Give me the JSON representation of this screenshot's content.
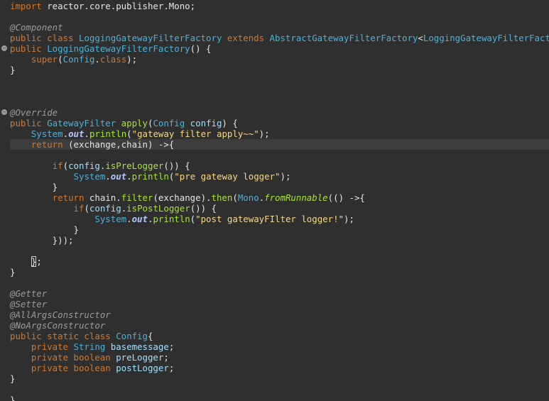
{
  "lines": [
    {
      "current": false,
      "fold": false,
      "tokens": [
        {
          "c": "t-kw",
          "t": "import "
        },
        {
          "c": "t-text",
          "t": "reactor.core.publisher.Mono;"
        }
      ]
    },
    {
      "current": false,
      "fold": false,
      "tokens": []
    },
    {
      "current": false,
      "fold": false,
      "tokens": [
        {
          "c": "t-ann",
          "t": "@Component"
        }
      ]
    },
    {
      "current": false,
      "fold": false,
      "tokens": [
        {
          "c": "t-kw",
          "t": "public class "
        },
        {
          "c": "t-type",
          "t": "LoggingGatewayFilterFactory "
        },
        {
          "c": "t-kw",
          "t": "extends "
        },
        {
          "c": "t-type",
          "t": "AbstractGatewayFilterFactory"
        },
        {
          "c": "t-text",
          "t": "<"
        },
        {
          "c": "t-type",
          "t": "LoggingGatewayFilterFactor"
        }
      ]
    },
    {
      "current": false,
      "fold": true,
      "tokens": [
        {
          "c": "t-kw",
          "t": "public "
        },
        {
          "c": "t-type",
          "t": "LoggingGatewayFilterFactory"
        },
        {
          "c": "t-text",
          "t": "() {"
        }
      ]
    },
    {
      "current": false,
      "fold": false,
      "tokens": [
        {
          "c": "t-text",
          "t": "    "
        },
        {
          "c": "t-kw",
          "t": "super"
        },
        {
          "c": "t-text",
          "t": "("
        },
        {
          "c": "t-type",
          "t": "Config"
        },
        {
          "c": "t-text",
          "t": "."
        },
        {
          "c": "t-kw",
          "t": "class"
        },
        {
          "c": "t-text",
          "t": ");"
        }
      ]
    },
    {
      "current": false,
      "fold": false,
      "tokens": [
        {
          "c": "t-text",
          "t": "}"
        }
      ]
    },
    {
      "current": false,
      "fold": false,
      "tokens": []
    },
    {
      "current": false,
      "fold": false,
      "tokens": []
    },
    {
      "current": false,
      "fold": false,
      "tokens": []
    },
    {
      "current": false,
      "fold": true,
      "tokens": [
        {
          "c": "t-ann",
          "t": "@Override"
        }
      ]
    },
    {
      "current": false,
      "fold": false,
      "tokens": [
        {
          "c": "t-kw",
          "t": "public "
        },
        {
          "c": "t-type",
          "t": "GatewayFilter "
        },
        {
          "c": "t-method",
          "t": "apply"
        },
        {
          "c": "t-text",
          "t": "("
        },
        {
          "c": "t-type",
          "t": "Config "
        },
        {
          "c": "t-field",
          "t": "config"
        },
        {
          "c": "t-text",
          "t": ") {"
        }
      ]
    },
    {
      "current": false,
      "fold": false,
      "tokens": [
        {
          "c": "t-text",
          "t": "    "
        },
        {
          "c": "t-type",
          "t": "System"
        },
        {
          "c": "t-text",
          "t": "."
        },
        {
          "c": "t-static",
          "t": "out"
        },
        {
          "c": "t-text",
          "t": "."
        },
        {
          "c": "t-method",
          "t": "println"
        },
        {
          "c": "t-text",
          "t": "("
        },
        {
          "c": "t-str",
          "t": "\"gateway filter apply~~\""
        },
        {
          "c": "t-text",
          "t": ");"
        }
      ]
    },
    {
      "current": true,
      "fold": false,
      "tokens": [
        {
          "c": "t-text",
          "t": "    "
        },
        {
          "c": "t-kw",
          "t": "return "
        },
        {
          "c": "t-text",
          "t": "(exchange,chain) ->{"
        }
      ]
    },
    {
      "current": false,
      "fold": false,
      "tokens": []
    },
    {
      "current": false,
      "fold": false,
      "tokens": [
        {
          "c": "t-text",
          "t": "        "
        },
        {
          "c": "t-kw",
          "t": "if"
        },
        {
          "c": "t-text",
          "t": "("
        },
        {
          "c": "t-field",
          "t": "config"
        },
        {
          "c": "t-text",
          "t": "."
        },
        {
          "c": "t-method",
          "t": "isPreLogger"
        },
        {
          "c": "t-text",
          "t": "()) {"
        }
      ]
    },
    {
      "current": false,
      "fold": false,
      "tokens": [
        {
          "c": "t-text",
          "t": "            "
        },
        {
          "c": "t-type",
          "t": "System"
        },
        {
          "c": "t-text",
          "t": "."
        },
        {
          "c": "t-static",
          "t": "out"
        },
        {
          "c": "t-text",
          "t": "."
        },
        {
          "c": "t-method",
          "t": "println"
        },
        {
          "c": "t-text",
          "t": "("
        },
        {
          "c": "t-str",
          "t": "\"pre gateway logger\""
        },
        {
          "c": "t-text",
          "t": ");"
        }
      ]
    },
    {
      "current": false,
      "fold": false,
      "tokens": [
        {
          "c": "t-text",
          "t": "        }"
        }
      ]
    },
    {
      "current": false,
      "fold": false,
      "tokens": [
        {
          "c": "t-text",
          "t": "        "
        },
        {
          "c": "t-kw",
          "t": "return "
        },
        {
          "c": "t-text",
          "t": "chain."
        },
        {
          "c": "t-method",
          "t": "filter"
        },
        {
          "c": "t-text",
          "t": "(exchange)."
        },
        {
          "c": "t-method",
          "t": "then"
        },
        {
          "c": "t-text",
          "t": "("
        },
        {
          "c": "t-type",
          "t": "Mono"
        },
        {
          "c": "t-text",
          "t": "."
        },
        {
          "c": "t-fn",
          "t": "fromRunnable"
        },
        {
          "c": "t-text",
          "t": "(() ->{"
        }
      ]
    },
    {
      "current": false,
      "fold": false,
      "tokens": [
        {
          "c": "t-text",
          "t": "            "
        },
        {
          "c": "t-kw",
          "t": "if"
        },
        {
          "c": "t-text",
          "t": "("
        },
        {
          "c": "t-field",
          "t": "config"
        },
        {
          "c": "t-text",
          "t": "."
        },
        {
          "c": "t-method",
          "t": "isPostLogger"
        },
        {
          "c": "t-text",
          "t": "()) {"
        }
      ]
    },
    {
      "current": false,
      "fold": false,
      "tokens": [
        {
          "c": "t-text",
          "t": "                "
        },
        {
          "c": "t-type",
          "t": "System"
        },
        {
          "c": "t-text",
          "t": "."
        },
        {
          "c": "t-static",
          "t": "out"
        },
        {
          "c": "t-text",
          "t": "."
        },
        {
          "c": "t-method",
          "t": "println"
        },
        {
          "c": "t-text",
          "t": "("
        },
        {
          "c": "t-str",
          "t": "\"post gatewayFIlter logger!\""
        },
        {
          "c": "t-text",
          "t": ");"
        }
      ]
    },
    {
      "current": false,
      "fold": false,
      "tokens": [
        {
          "c": "t-text",
          "t": "            }"
        }
      ]
    },
    {
      "current": false,
      "fold": false,
      "tokens": [
        {
          "c": "t-text",
          "t": "        }));"
        }
      ]
    },
    {
      "current": false,
      "fold": false,
      "tokens": []
    },
    {
      "current": false,
      "fold": false,
      "tokens": [
        {
          "c": "t-text",
          "t": "    "
        },
        {
          "c": "t-text cursor",
          "t": "}"
        },
        {
          "c": "t-text",
          "t": ";"
        }
      ]
    },
    {
      "current": false,
      "fold": false,
      "tokens": [
        {
          "c": "t-text",
          "t": "}"
        }
      ]
    },
    {
      "current": false,
      "fold": false,
      "tokens": []
    },
    {
      "current": false,
      "fold": false,
      "tokens": [
        {
          "c": "t-ann",
          "t": "@Getter"
        }
      ]
    },
    {
      "current": false,
      "fold": false,
      "tokens": [
        {
          "c": "t-ann",
          "t": "@Setter"
        }
      ]
    },
    {
      "current": false,
      "fold": false,
      "tokens": [
        {
          "c": "t-ann",
          "t": "@AllArgsConstructor"
        }
      ]
    },
    {
      "current": false,
      "fold": false,
      "tokens": [
        {
          "c": "t-ann",
          "t": "@NoArgsConstructor"
        }
      ]
    },
    {
      "current": false,
      "fold": false,
      "tokens": [
        {
          "c": "t-kw",
          "t": "public static class "
        },
        {
          "c": "t-type",
          "t": "Config"
        },
        {
          "c": "t-text",
          "t": "{"
        }
      ]
    },
    {
      "current": false,
      "fold": false,
      "tokens": [
        {
          "c": "t-text",
          "t": "    "
        },
        {
          "c": "t-kw",
          "t": "private "
        },
        {
          "c": "t-type",
          "t": "String "
        },
        {
          "c": "t-field",
          "t": "basemessage"
        },
        {
          "c": "t-text",
          "t": ";"
        }
      ]
    },
    {
      "current": false,
      "fold": false,
      "tokens": [
        {
          "c": "t-text",
          "t": "    "
        },
        {
          "c": "t-kw",
          "t": "private boolean "
        },
        {
          "c": "t-field",
          "t": "preLogger"
        },
        {
          "c": "t-text",
          "t": ";"
        }
      ]
    },
    {
      "current": false,
      "fold": false,
      "tokens": [
        {
          "c": "t-text",
          "t": "    "
        },
        {
          "c": "t-kw",
          "t": "private boolean "
        },
        {
          "c": "t-field",
          "t": "postLogger"
        },
        {
          "c": "t-text",
          "t": ";"
        }
      ]
    },
    {
      "current": false,
      "fold": false,
      "tokens": [
        {
          "c": "t-text",
          "t": "}"
        }
      ]
    },
    {
      "current": false,
      "fold": false,
      "tokens": []
    },
    {
      "current": false,
      "fold": false,
      "tokens": [
        {
          "c": "t-text",
          "t": "}"
        }
      ]
    }
  ]
}
